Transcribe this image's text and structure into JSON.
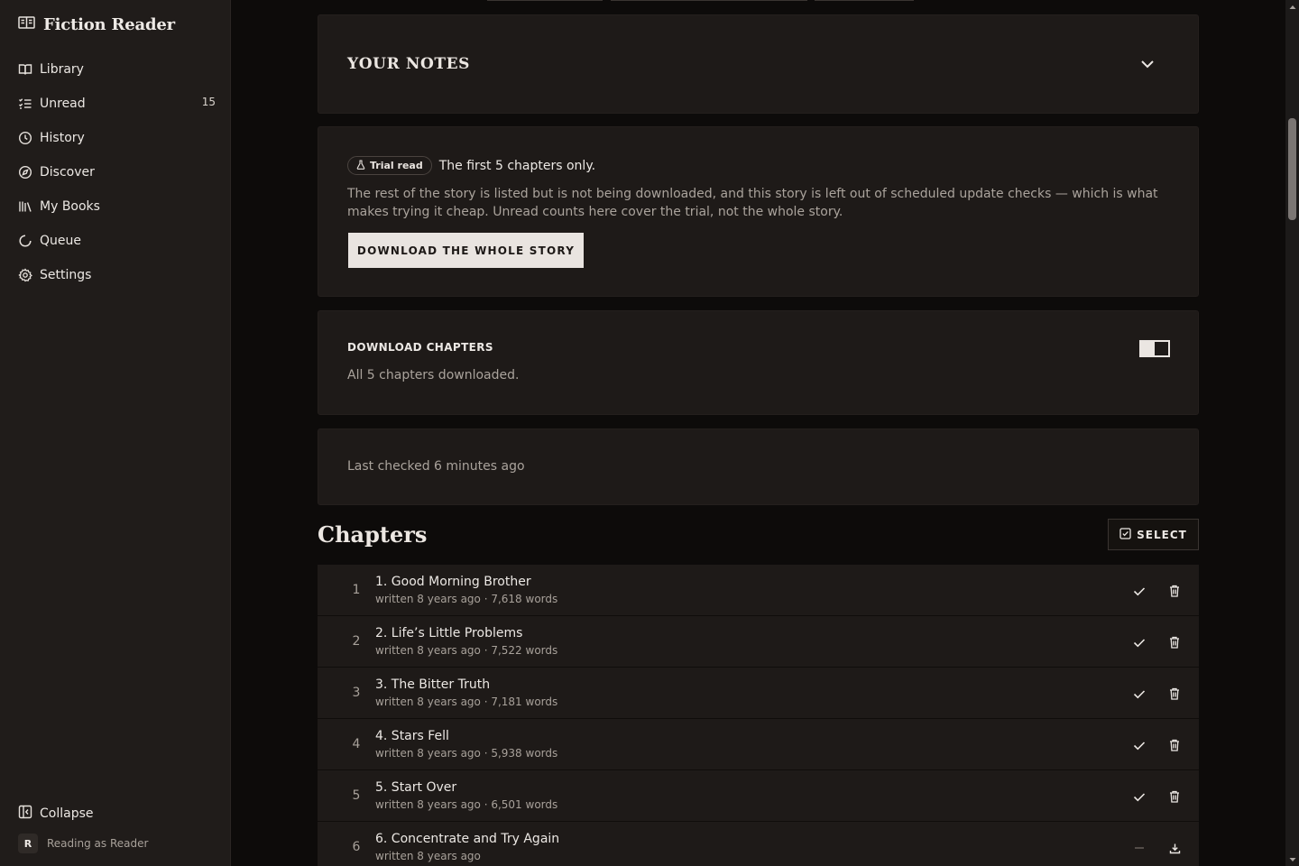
{
  "app": {
    "title": "Fiction Reader",
    "accent": "#e9e4e0",
    "background": "#0d0b0a",
    "card_background": "#1e1a18"
  },
  "sidebar": {
    "items": [
      {
        "label": "Library",
        "icon": "book-open-icon"
      },
      {
        "label": "Unread",
        "icon": "list-checks-icon",
        "badge": "15"
      },
      {
        "label": "History",
        "icon": "clock-icon"
      },
      {
        "label": "Discover",
        "icon": "compass-icon"
      },
      {
        "label": "My Books",
        "icon": "library-icon"
      },
      {
        "label": "Queue",
        "icon": "loader-icon"
      },
      {
        "label": "Settings",
        "icon": "gear-icon"
      }
    ],
    "collapse_label": "Collapse",
    "account": {
      "initial": "R",
      "label": "Reading as Reader"
    }
  },
  "notes": {
    "title": "YOUR NOTES"
  },
  "trial": {
    "pill_label": "Trial read",
    "headline": "The first 5 chapters only.",
    "description": "The rest of the story is listed but is not being downloaded, and this story is left out of scheduled update checks — which is what makes trying it cheap. Unread counts here cover the trial, not the whole story.",
    "button_label": "DOWNLOAD THE WHOLE STORY"
  },
  "download": {
    "title": "DOWNLOAD CHAPTERS",
    "status": "All 5 chapters downloaded.",
    "toggle_on": true
  },
  "last_checked": "Last checked 6 minutes ago",
  "chapters": {
    "heading": "Chapters",
    "select_label": "SELECT",
    "rows": [
      {
        "num": "1",
        "title": "1. Good Morning Brother",
        "meta": "written 8 years ago · 7,618 words",
        "downloaded": true
      },
      {
        "num": "2",
        "title": "2. Life’s Little Problems",
        "meta": "written 8 years ago · 7,522 words",
        "downloaded": true
      },
      {
        "num": "3",
        "title": "3. The Bitter Truth",
        "meta": "written 8 years ago · 7,181 words",
        "downloaded": true
      },
      {
        "num": "4",
        "title": "4. Stars Fell",
        "meta": "written 8 years ago · 5,938 words",
        "downloaded": true
      },
      {
        "num": "5",
        "title": "5. Start Over",
        "meta": "written 8 years ago · 6,501 words",
        "downloaded": true
      },
      {
        "num": "6",
        "title": "6. Concentrate and Try Again",
        "meta": "written 8 years ago",
        "downloaded": false
      }
    ]
  }
}
